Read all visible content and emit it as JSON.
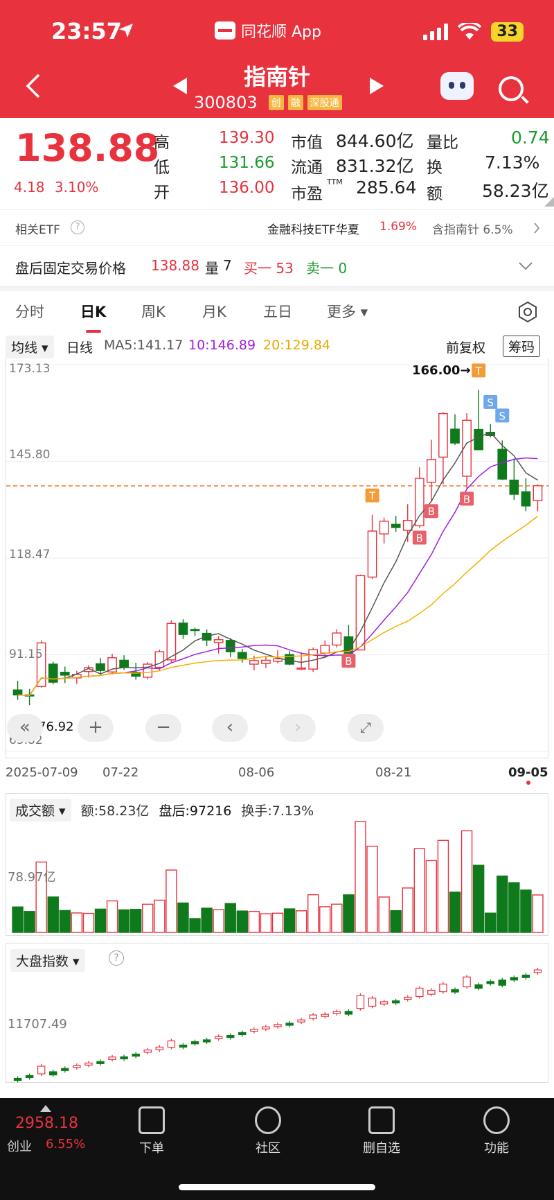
{
  "status": {
    "time": "23:57",
    "app_name": "同花顺 App",
    "battery": "33"
  },
  "header": {
    "title": "指南针",
    "code": "300803",
    "tags": [
      "创",
      "融",
      "深股通"
    ]
  },
  "quote": {
    "price": "138.88",
    "change": "4.18",
    "change_pct": "3.10%",
    "high_label": "高",
    "high": "139.30",
    "low_label": "低",
    "low": "131.66",
    "open_label": "开",
    "open": "136.00",
    "mcap_label": "市值",
    "mcap": "844.60亿",
    "float_label": "流通",
    "float": "831.32亿",
    "pe_label": "市盈",
    "pe_sup": "TTM",
    "pe": "285.64",
    "volratio_label": "量比",
    "volratio": "0.74",
    "turnover_label": "换",
    "turnover": "7.13%",
    "amount_label": "额",
    "amount": "58.23亿"
  },
  "etf": {
    "label": "相关ETF",
    "name": "金融科技ETF华夏",
    "pct": "1.69%",
    "weight": "含指南针 6.5%"
  },
  "post": {
    "label": "盘后固定交易价格",
    "price": "138.88",
    "vol_label": "量",
    "vol": "7",
    "buy": "买一 53",
    "sell": "卖一 0"
  },
  "tabs": [
    "分时",
    "日K",
    "周K",
    "月K",
    "五日",
    "更多"
  ],
  "ma": {
    "type": "均线",
    "period": "日线",
    "ma5": "MA5:141.17",
    "ma10": "10:146.89",
    "ma20": "20:129.84",
    "adjust": "前复权",
    "chips": "筹码"
  },
  "kchart": {
    "y_labels": [
      "173.13",
      "145.80",
      "118.47",
      "91.15",
      "63.82"
    ],
    "max_label": "166.00→",
    "min_label": "76.92",
    "x_labels": [
      "2025-07-09",
      "07-22",
      "08-06",
      "08-21",
      "09-05"
    ],
    "markers": [
      "T",
      "S",
      "S",
      "T",
      "B",
      "B",
      "B",
      "B"
    ]
  },
  "volume": {
    "selector": "成交额",
    "amount": "额:58.23亿",
    "after": "盘后:97216",
    "turnover": "换手:7.13%",
    "y_label": "78.97亿"
  },
  "index": {
    "selector": "大盘指数",
    "help": "?",
    "y_label": "11707.49"
  },
  "bottom": {
    "index_value": "2958.18",
    "index_name": "创业",
    "index_pct": "6.55%",
    "nav": [
      "下单",
      "社区",
      "删自选",
      "功能"
    ]
  },
  "colors": {
    "up": "#e8323e",
    "down": "#0e7a1c",
    "ma5": "#555555",
    "ma10": "#a020e0",
    "ma20": "#f2b100",
    "brand": "#e8323e"
  },
  "chart_data": {
    "type": "candlestick",
    "dates_labeled": [
      "2025-07-09",
      "07-22",
      "08-06",
      "08-21",
      "09-05"
    ],
    "ylim": [
      63.82,
      173.13
    ],
    "candles": [
      [
        81.2,
        83.8,
        78.4,
        79.8
      ],
      [
        79.8,
        81.5,
        76.9,
        79.5
      ],
      [
        82.2,
        95.2,
        81.8,
        94.5
      ],
      [
        88.5,
        89.2,
        82.8,
        83.4
      ],
      [
        86.2,
        87.8,
        83.2,
        85.4
      ],
      [
        84.6,
        86.6,
        82.9,
        85.6
      ],
      [
        86.4,
        88.2,
        84.7,
        87.5
      ],
      [
        88.6,
        90.3,
        85.9,
        86.7
      ],
      [
        86.3,
        91.4,
        85.6,
        90.3
      ],
      [
        89.6,
        91.0,
        86.9,
        87.6
      ],
      [
        86.2,
        88.9,
        84.1,
        85.1
      ],
      [
        84.8,
        89.1,
        84.2,
        88.5
      ],
      [
        87.6,
        92.6,
        86.8,
        92.0
      ],
      [
        89.7,
        100.9,
        88.9,
        100.0
      ],
      [
        100.1,
        101.2,
        95.6,
        96.9
      ],
      [
        98.3,
        98.8,
        96.5,
        98.0
      ],
      [
        97.2,
        98.3,
        93.6,
        95.3
      ],
      [
        94.6,
        96.4,
        91.5,
        95.4
      ],
      [
        95.2,
        95.9,
        90.5,
        92.0
      ],
      [
        91.8,
        92.8,
        88.9,
        90.1
      ],
      [
        88.5,
        90.9,
        86.7,
        89.5
      ],
      [
        88.7,
        90.9,
        87.4,
        89.6
      ],
      [
        89.3,
        92.5,
        88.7,
        90.0
      ],
      [
        91.2,
        92.2,
        88.2,
        88.5
      ],
      [
        87.4,
        91.8,
        86.8,
        87.4
      ],
      [
        87.1,
        93.2,
        86.3,
        92.6
      ],
      [
        91.6,
        95.2,
        90.2,
        93.8
      ],
      [
        93.9,
        98.3,
        93.2,
        97.3
      ],
      [
        96.2,
        99.6,
        92.2,
        91.6
      ],
      [
        92.5,
        113.8,
        92.5,
        113.5
      ],
      [
        113.1,
        130.7,
        112.6,
        126.1
      ],
      [
        125.3,
        129.9,
        122.6,
        128.9
      ],
      [
        128.0,
        130.4,
        125.9,
        127.1
      ],
      [
        126.3,
        133.7,
        123.0,
        129.1
      ],
      [
        127.6,
        144.1,
        127.0,
        141.0
      ],
      [
        139.9,
        151.9,
        134.5,
        146.3
      ],
      [
        147.0,
        159.7,
        139.3,
        159.3
      ],
      [
        154.9,
        159.1,
        150.4,
        151.0
      ],
      [
        141.6,
        159.4,
        138.0,
        157.4
      ],
      [
        154.8,
        166.0,
        149.7,
        149.1
      ],
      [
        154.0,
        156.3,
        152.6,
        153.1
      ],
      [
        149.2,
        151.7,
        140.5,
        140.8
      ],
      [
        140.5,
        146.6,
        134.9,
        136.5
      ],
      [
        137.2,
        141.0,
        131.7,
        133.2
      ],
      [
        134.7,
        139.3,
        131.7,
        138.9
      ]
    ],
    "ma5_label": "MA5:141.17",
    "ma10_label": "10:146.89",
    "ma20_label": "20:129.84",
    "volume_ylabel": "78.97亿",
    "index_ylabel": "11707.49"
  }
}
